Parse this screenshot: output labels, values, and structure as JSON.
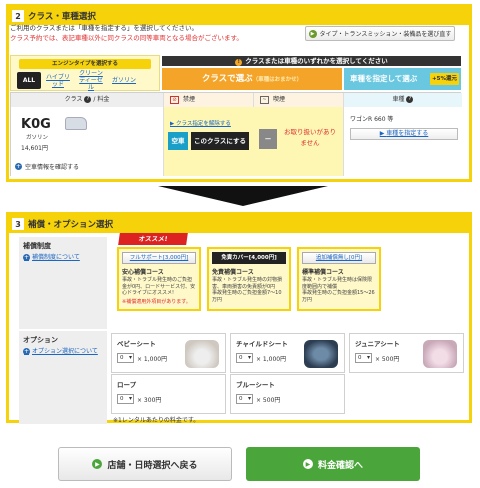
{
  "section2": {
    "num": "2",
    "title": "クラス・車種選択",
    "intro_line1": "ご利用のクラスまたは「車種を指定する」を選択してください。",
    "intro_line2": "クラス予約では、表記車種以外に同クラスの同等車両となる場合がございます。",
    "guide_button": "タイプ・トランスミッション・装備品を選び直す",
    "engine": {
      "title": "エンジンタイプを選択する",
      "options": [
        "ALL",
        "ハイブリッド",
        "クリーンディーゼル",
        "ガソリン"
      ]
    },
    "banner": "クラスまたは車種のいずれかを選択してください",
    "class_tab": "クラスで選ぶ",
    "class_tab_note": "（車種はおまかせ）",
    "car_tab": "車種を指定して選ぶ",
    "car_tab_points": "+5%還元",
    "table": {
      "col_class": "クラス",
      "col_fee": "料金",
      "col_kinen": "禁煙",
      "col_kitsuen": "喫煙",
      "col_shashu": "車種",
      "class_code": "K0G",
      "fuel": "ガソリン",
      "price": "14,601円",
      "vehicle_info": "空車情報を確認する",
      "cancel_link": "クラス指定を解除する",
      "empty_label": "空車",
      "choose_button": "このクラスにする",
      "dash": "－",
      "not_available": "お取り扱いがありません",
      "car_model": "ワゴンR 660 等",
      "specify_button": "車種を指定する"
    }
  },
  "section3": {
    "num": "3",
    "title": "補償・オプション選択",
    "hosho": {
      "label": "補償制度",
      "link": "補償制度について",
      "recommend": "オススメ!",
      "plans": [
        {
          "button": "フルサポート[3,000円]",
          "name": "安心補償コース",
          "desc": "事故・トラブル発生時のご負担金が0円、ロードサービス付、安心ドライブにオススメ!",
          "note": "※補償適用外項目があります。"
        },
        {
          "button": "免責カバー[4,000円]",
          "name": "免責補償コース",
          "desc": "事故・トラブル発生時の対物損害、車両損害の免責額が0円",
          "note": "事故発生時のご負担金額7～10万円"
        },
        {
          "button": "追加補償無し[0円]",
          "name": "標準補償コース",
          "desc": "事故・トラブル発生時は保険限度範囲内で補償",
          "note": "事故発生時のご負担金額15～26万円"
        }
      ]
    },
    "option": {
      "label": "オプション",
      "link": "オプション選択について",
      "items": [
        {
          "name": "ベビーシート",
          "qty": "0",
          "price": "× 1,000円"
        },
        {
          "name": "チャイルドシート",
          "qty": "0",
          "price": "× 1,000円"
        },
        {
          "name": "ジュニアシート",
          "qty": "0",
          "price": "× 500円"
        },
        {
          "name": "ロープ",
          "qty": "0",
          "price": "× 300円"
        },
        {
          "name": "ブルーシート",
          "qty": "0",
          "price": "× 500円"
        }
      ],
      "note": "※1レンタルあたりの料金です。"
    }
  },
  "buttons": {
    "back": "店舗・日時選択へ戻る",
    "next": "料金確認へ"
  },
  "colors": {
    "accent_yellow": "#f5d20a",
    "class_orange": "#f4a428",
    "car_blue": "#6ac7e0",
    "next_green": "#4aa63a",
    "alert_red": "#e03030"
  }
}
